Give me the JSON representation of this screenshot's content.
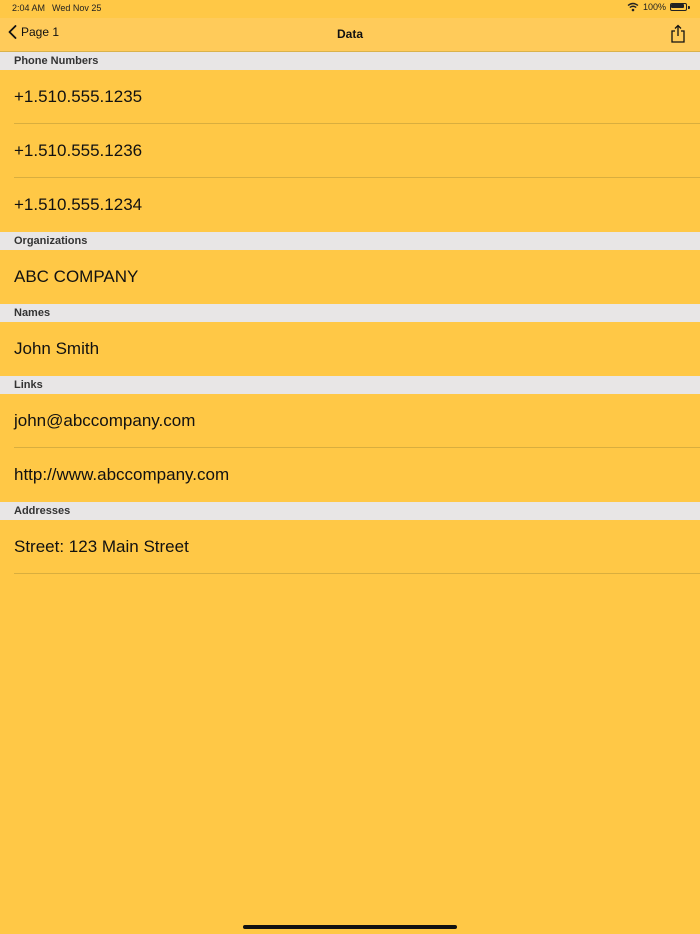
{
  "status_bar": {
    "time": "2:04 AM",
    "date": "Wed Nov 25",
    "battery": "100%"
  },
  "nav": {
    "back_label": "Page 1",
    "title": "Data"
  },
  "sections": {
    "phone": {
      "header": "Phone Numbers",
      "items": [
        "+1.510.555.1235",
        "+1.510.555.1236",
        "+1.510.555.1234"
      ]
    },
    "organizations": {
      "header": "Organizations",
      "items": [
        "ABC COMPANY"
      ]
    },
    "names": {
      "header": "Names",
      "items": [
        "John Smith"
      ]
    },
    "links": {
      "header": "Links",
      "items": [
        "john@abccompany.com",
        "http://www.abccompany.com"
      ]
    },
    "addresses": {
      "header": "Addresses",
      "items": [
        "Street: 123 Main Street"
      ]
    }
  },
  "colors": {
    "background": "#FFC846",
    "section_header": "#E8E6E6",
    "separator": "#D9AE3E"
  }
}
